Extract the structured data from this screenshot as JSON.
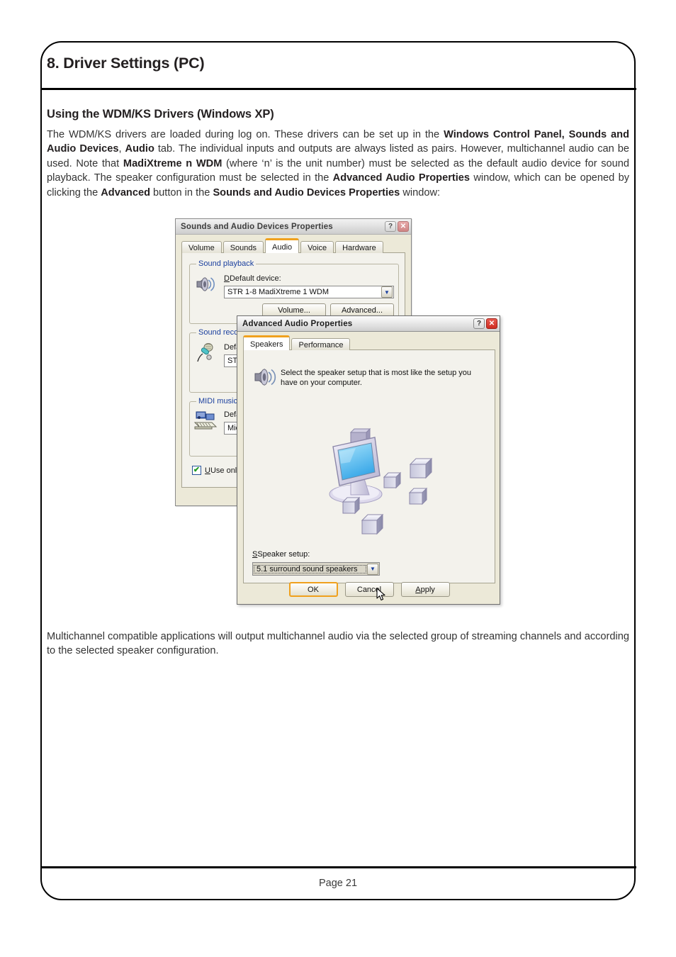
{
  "document": {
    "chapter_title": "8. Driver Settings (PC)",
    "page_footer": "Page 21",
    "section_heading": "Using the WDM/KS Drivers (Windows XP)",
    "paragraph_bottom": "Multichannel compatible applications will output multichannel audio via the selected group of streaming channels and according to the selected speaker configuration."
  },
  "paragraph_top": {
    "p1": "The WDM/KS drivers are loaded during log on. These drivers can be set up in the ",
    "b1": "Windows Control Panel, Sounds and Audio Devices",
    "p2": ", ",
    "b2": "Audio",
    "p3": " tab. The individual inputs and outputs are always listed as pairs. However, multichannel audio can be used. Note that ",
    "b3": "MadiXtreme n WDM",
    "p4": " (where ‘n’ is the unit number) must be selected as the default audio device for sound playback. The speaker configuration must be selected in the ",
    "b4": "Advanced Audio Properties",
    "p5": " window, which can be opened by clicking the ",
    "b5": "Advanced",
    "p6": " button in the ",
    "b6": "Sounds and Audio Devices Properties",
    "p7": " window:"
  },
  "dialog_sounds": {
    "title": "Sounds and Audio Devices Properties",
    "help_button": "?",
    "close_button": "✕",
    "tabs": [
      {
        "label": "Volume",
        "selected": false
      },
      {
        "label": "Sounds",
        "selected": false
      },
      {
        "label": "Audio",
        "selected": true
      },
      {
        "label": "Voice",
        "selected": false
      },
      {
        "label": "Hardware",
        "selected": false
      }
    ],
    "sound_playback": {
      "group_title": "Sound playback",
      "field_label": "Default device:",
      "device_value": "STR 1-8 MadiXtreme 1 WDM",
      "volume_button": "Volume...",
      "advanced_button": "Advanced..."
    },
    "sound_recording": {
      "group_title": "Sound record",
      "field_label": "Defa",
      "device_value": "STR"
    },
    "midi_playback": {
      "group_title": "MIDI music p",
      "field_label": "Defa",
      "device_value": "Mic"
    },
    "use_only_default": {
      "label": "Use only de",
      "checked": true,
      "check_glyph": "✔"
    }
  },
  "dialog_advanced": {
    "title": "Advanced Audio Properties",
    "help_button": "?",
    "close_button": "✕",
    "tabs": [
      {
        "label": "Speakers",
        "selected": true
      },
      {
        "label": "Performance",
        "selected": false
      }
    ],
    "description": "Select the speaker setup that is most like the setup you have on your computer.",
    "speaker_setup_label": "Speaker setup:",
    "speaker_setup_value": "5.1 surround sound speakers",
    "buttons": {
      "ok": "OK",
      "cancel": "Cancel",
      "apply": "Apply"
    }
  },
  "colors": {
    "accent_orange": "#f0a11e",
    "group_title_blue": "#1a3f9e",
    "dialog_face": "#f3f2ec",
    "text_dark": "#231f20"
  }
}
